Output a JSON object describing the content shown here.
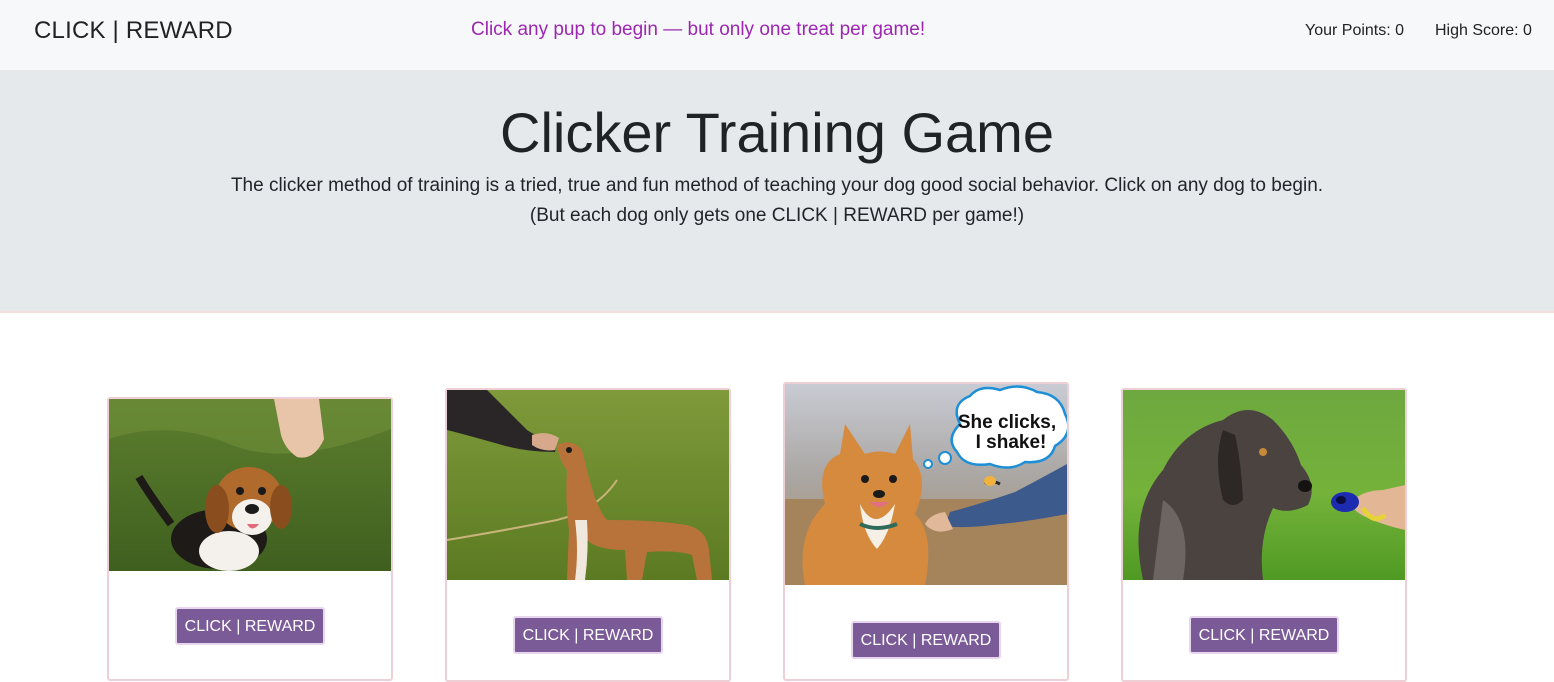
{
  "navbar": {
    "brand": "CLICK | REWARD",
    "message": "Click any pup to begin — but only one treat per game!",
    "points": "Your Points: 0",
    "high_score": "High Score: 0"
  },
  "jumbotron": {
    "title": "Clicker Training Game",
    "lead_line1": "The clicker method of training is a tried, true and fun method of teaching your dog good social behavior. Click on any dog to begin.",
    "lead_line2": "(But each dog only gets one CLICK | REWARD per game!)"
  },
  "cards": [
    {
      "button": "CLICK | REWARD",
      "image": "beagle-photo"
    },
    {
      "button": "CLICK | REWARD",
      "image": "greyhound-photo"
    },
    {
      "button": "CLICK | REWARD",
      "image": "corgi-photo",
      "bubble_line1": "She clicks,",
      "bubble_line2": "I shake!"
    },
    {
      "button": "CLICK | REWARD",
      "image": "griffon-photo"
    }
  ],
  "colors": {
    "accent_purple": "#9c27b0",
    "button_purple": "#7a5a97",
    "jumbotron_bg": "#e6e9ec",
    "card_border": "#efcfd6"
  }
}
